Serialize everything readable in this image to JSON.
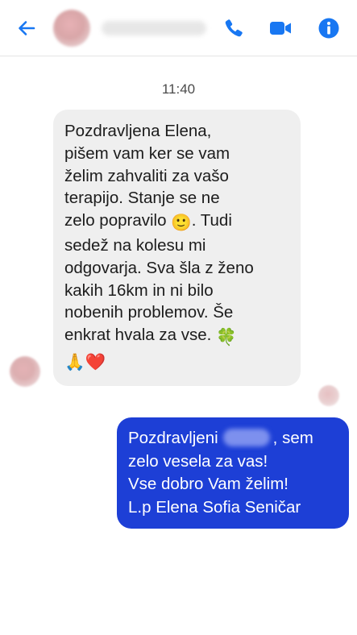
{
  "header": {
    "contact_name": "",
    "icons": {
      "back": "arrow-left-icon",
      "call": "phone-icon",
      "video": "video-camera-icon",
      "info": "info-icon"
    }
  },
  "colors": {
    "accent": "#1877f2",
    "incoming_bubble": "#efefef",
    "outgoing_bubble": "#1d3fd6",
    "outgoing_text": "#ffffff"
  },
  "conversation": {
    "timestamp": "11:40",
    "incoming_message": {
      "lines": [
        "Pozdravljena Elena,",
        "pišem vam ker se vam",
        "želim zahvaliti za vašo",
        "terapijo. Stanje se ne",
        "zelo popravilo",
        "sedež na kolesu mi",
        "odgovarja. Sva šla z ženo",
        "kakih 16km in ni bilo",
        "nobenih problemov. Še",
        "enkrat hvala za vse."
      ],
      "line5_after_emoji": ". Tudi",
      "emojis": [
        "🙂",
        "🍀",
        "🙏",
        "❤️"
      ]
    },
    "outgoing_message": {
      "line1_start": "Pozdravljeni",
      "line1_end": ", sem",
      "lines": [
        "zelo vesela za vas!",
        "Vse dobro Vam želim!",
        "L.p Elena Sofia Seničar"
      ]
    }
  }
}
